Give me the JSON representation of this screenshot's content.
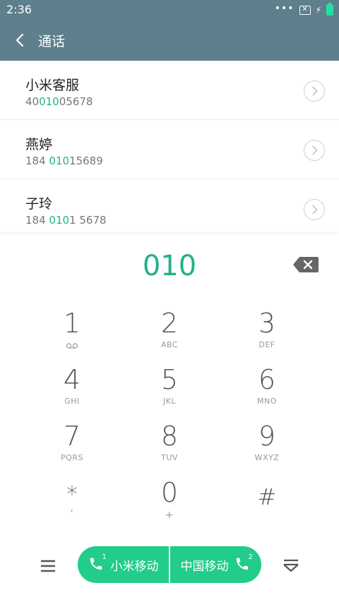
{
  "status": {
    "time": "2:36"
  },
  "appbar": {
    "title": "通话"
  },
  "results": [
    {
      "name": "小米客服",
      "num_pre": "40",
      "num_hl": "010",
      "num_post": "05678"
    },
    {
      "name": "燕婷",
      "num_pre": "184 ",
      "num_hl": "010",
      "num_post": "15689"
    },
    {
      "name": "子玲",
      "num_pre": "184 ",
      "num_hl": "010",
      "num_post": "1 5678"
    }
  ],
  "dialer": {
    "input": "010",
    "keys": [
      {
        "digit": "1",
        "letters": ""
      },
      {
        "digit": "2",
        "letters": "ABC"
      },
      {
        "digit": "3",
        "letters": "DEF"
      },
      {
        "digit": "4",
        "letters": "GHI"
      },
      {
        "digit": "5",
        "letters": "JKL"
      },
      {
        "digit": "6",
        "letters": "MNO"
      },
      {
        "digit": "7",
        "letters": "PQRS"
      },
      {
        "digit": "8",
        "letters": "TUV"
      },
      {
        "digit": "9",
        "letters": "WXYZ"
      },
      {
        "digit": "*",
        "letters": ","
      },
      {
        "digit": "0",
        "letters": "+"
      },
      {
        "digit": "#",
        "letters": ""
      }
    ]
  },
  "call": {
    "sim1_label": "小米移动",
    "sim1_badge": "1",
    "sim2_label": "中国移动",
    "sim2_badge": "2"
  },
  "colors": {
    "accent": "#22b08a",
    "bar": "#5e7f8b",
    "call_button": "#22cc8a",
    "highlight": "#1fb57f"
  }
}
